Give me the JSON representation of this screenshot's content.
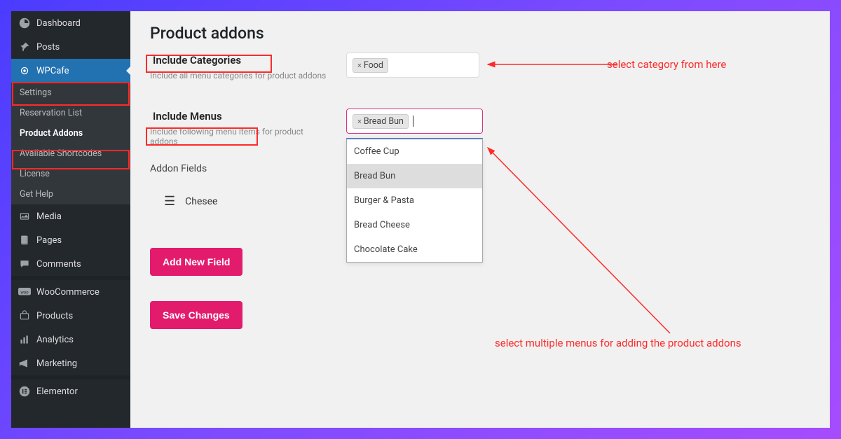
{
  "sidebar": {
    "top": [
      {
        "icon": "dashboard",
        "label": "Dashboard"
      },
      {
        "icon": "pin",
        "label": "Posts"
      }
    ],
    "active": {
      "icon": "wpcafe",
      "label": "WPCafe"
    },
    "sub": [
      {
        "label": "Settings"
      },
      {
        "label": "Reservation List"
      },
      {
        "label": "Product Addons",
        "current": true
      },
      {
        "label": "Available Shortcodes"
      },
      {
        "label": "License"
      },
      {
        "label": "Get Help"
      }
    ],
    "bottom": [
      {
        "icon": "media",
        "label": "Media"
      },
      {
        "icon": "pages",
        "label": "Pages"
      },
      {
        "icon": "comments",
        "label": "Comments"
      },
      {
        "icon": "woo",
        "label": "WooCommerce"
      },
      {
        "icon": "products",
        "label": "Products"
      },
      {
        "icon": "analytics",
        "label": "Analytics"
      },
      {
        "icon": "marketing",
        "label": "Marketing"
      },
      {
        "icon": "elementor",
        "label": "Elementor"
      }
    ]
  },
  "page": {
    "title": "Product addons",
    "include_categories": {
      "label": "Include Categories",
      "desc": "Include all menu categories for product addons",
      "tags": [
        "Food"
      ]
    },
    "include_menus": {
      "label": "Include Menus",
      "desc": "Include following menu items for product addons",
      "tags": [
        "Bread Bun"
      ],
      "options": [
        "Coffee Cup",
        "Bread Bun",
        "Burger & Pasta",
        "Bread Cheese",
        "Chocolate Cake"
      ],
      "highlighted": "Bread Bun"
    },
    "addon_fields_label": "Addon Fields",
    "addon_items": [
      "Chesee"
    ],
    "buttons": {
      "add": "Add New Field",
      "save": "Save Changes"
    }
  },
  "annotations": {
    "cat": "select category from here",
    "menu": "select multiple menus for adding the product addons"
  }
}
